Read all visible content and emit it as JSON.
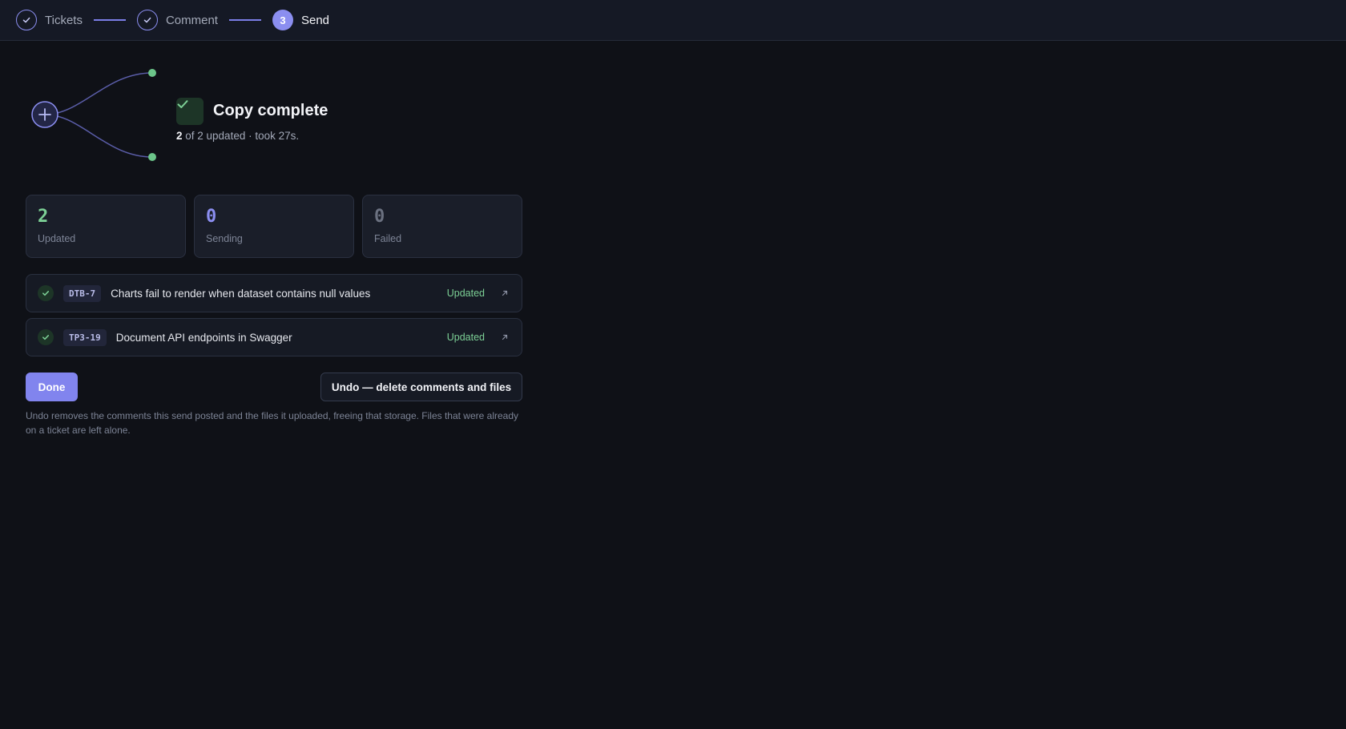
{
  "stepper": {
    "steps": [
      {
        "label": "Tickets",
        "state": "done"
      },
      {
        "label": "Comment",
        "state": "done"
      },
      {
        "label": "Send",
        "state": "active",
        "number": "3"
      }
    ]
  },
  "result": {
    "title": "Copy complete",
    "summary_count": "2",
    "summary_rest": " of 2 updated · took 27s."
  },
  "stats": [
    {
      "value": "2",
      "label": "Updated",
      "color": "#7ccf95"
    },
    {
      "value": "0",
      "label": "Sending",
      "color": "#8b8ef0"
    },
    {
      "value": "0",
      "label": "Failed",
      "color": "#6b7180"
    }
  ],
  "tickets": [
    {
      "key": "DTB-7",
      "title": "Charts fail to render when dataset contains null values",
      "status": "Updated"
    },
    {
      "key": "TP3-19",
      "title": "Document API endpoints in Swagger",
      "status": "Updated"
    }
  ],
  "actions": {
    "done_label": "Done",
    "undo_label": "Undo — delete comments and files"
  },
  "note": "Undo removes the comments this send posted and the files it uploaded, freeing that storage. Files that were already on a ticket are left alone.",
  "colors": {
    "accent": "#8184ee",
    "success": "#7ccf95",
    "background": "#0f1117"
  }
}
